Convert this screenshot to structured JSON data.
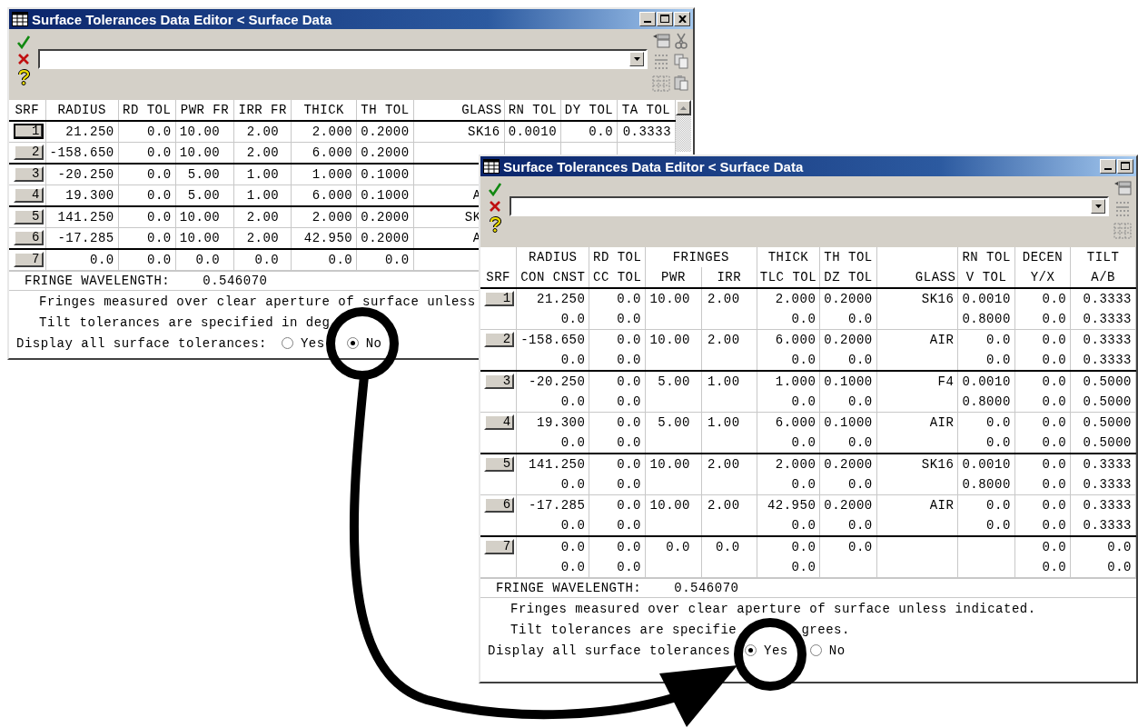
{
  "windows": [
    {
      "title": "Surface Tolerances Data Editor < Surface Data",
      "title_buttons": [
        {
          "kind": "minimize"
        },
        {
          "kind": "maximize"
        },
        {
          "kind": "close"
        }
      ],
      "tool_icons": [
        {
          "kind": "pages"
        },
        {
          "kind": "scissors"
        },
        {
          "kind": "sort"
        },
        {
          "kind": "copy"
        },
        {
          "kind": "grid"
        },
        {
          "kind": "clipboard"
        }
      ],
      "scrollbar": true,
      "header_rows": [
        {
          "srf": "SRF",
          "radius": "RADIUS",
          "rd_tol": "RD TOL",
          "pwr_fr": "PWR FR",
          "irr_fr": "IRR FR",
          "thick": "THICK",
          "th_tol": "TH TOL",
          "glass": "GLASS",
          "rn_tol": "RN TOL",
          "dy_tol": "DY TOL",
          "ta_tol": "TA TOL"
        }
      ],
      "rows": [
        {
          "surface": "1",
          "selected": true,
          "lines": [
            {
              "radius": "21.250",
              "rd_tol": "0.0",
              "pwr_fr": "10.00",
              "irr_fr": "2.00",
              "thick": "2.000",
              "th_tol": "0.2000",
              "glass": "SK16",
              "rn_tol": "0.0010",
              "dy_tol": "0.0",
              "ta_tol": "0.3333"
            }
          ]
        },
        {
          "surface": "2",
          "selected": false,
          "lines": [
            {
              "radius": "-158.650",
              "rd_tol": "0.0",
              "pwr_fr": "10.00",
              "irr_fr": "2.00",
              "thick": "6.000",
              "th_tol": "0.2000"
            }
          ]
        },
        {
          "surface": "3",
          "selected": false,
          "lines": [
            {
              "radius": "-20.250",
              "rd_tol": "0.0",
              "pwr_fr": "5.00",
              "irr_fr": "1.00",
              "thick": "1.000",
              "th_tol": "0.1000"
            }
          ]
        },
        {
          "surface": "4",
          "selected": false,
          "lines": [
            {
              "radius": "19.300",
              "rd_tol": "0.0",
              "pwr_fr": "5.00",
              "irr_fr": "1.00",
              "thick": "6.000",
              "th_tol": "0.1000",
              "glass": "A"
            }
          ]
        },
        {
          "surface": "5",
          "selected": false,
          "lines": [
            {
              "radius": "141.250",
              "rd_tol": "0.0",
              "pwr_fr": "10.00",
              "irr_fr": "2.00",
              "thick": "2.000",
              "th_tol": "0.2000",
              "glass": "SK"
            }
          ]
        },
        {
          "surface": "6",
          "selected": false,
          "lines": [
            {
              "radius": "-17.285",
              "rd_tol": "0.0",
              "pwr_fr": "10.00",
              "irr_fr": "2.00",
              "thick": "42.950",
              "th_tol": "0.2000",
              "glass": "A"
            }
          ]
        },
        {
          "surface": "7",
          "selected": false,
          "lines": [
            {
              "radius": "0.0",
              "rd_tol": "0.0",
              "pwr_fr": "0.0",
              "irr_fr": "0.0",
              "thick": "0.0",
              "th_tol": "0.0"
            }
          ]
        }
      ],
      "fringe_wavelength": {
        "label": "FRINGE WAVELENGTH:",
        "value": "0.546070"
      },
      "notes": [
        [
          "Fringes measured over clear aperture of surface unless"
        ],
        [
          "Tilt tolerances are specified in deg"
        ]
      ],
      "display_all": {
        "label": "Display all surface tolerances:",
        "options": [
          {
            "label": "Yes",
            "selected": false
          },
          {
            "label": "No",
            "selected": true
          }
        ]
      }
    },
    {
      "title": "Surface Tolerances Data Editor < Surface Data",
      "title_buttons": [
        {
          "kind": "minimize"
        },
        {
          "kind": "maximize"
        }
      ],
      "tool_icons": [
        {
          "kind": "pages"
        },
        {
          "kind": "sort"
        },
        {
          "kind": "grid"
        }
      ],
      "scrollbar": false,
      "header_rows": [
        {
          "radius": "RADIUS",
          "rd_tol": "RD TOL",
          "fringes": "FRINGES",
          "thick": "THICK",
          "th_tol": "TH TOL",
          "rn_tol": "RN TOL",
          "decen": "DECEN",
          "tilt": "TILT"
        },
        {
          "srf": "SRF",
          "radius": "CON CNST",
          "rd_tol": "CC TOL",
          "pwr": "PWR",
          "irr": "IRR",
          "thick": "TLC TOL",
          "th_tol": "DZ TOL",
          "glass": "GLASS",
          "rn_tol": "V TOL",
          "decen": "Y/X",
          "tilt": "A/B"
        }
      ],
      "rows": [
        {
          "surface": "1",
          "selected": false,
          "lines": [
            {
              "radius": "21.250",
              "rd_tol": "0.0",
              "pwr": "10.00",
              "irr": "2.00",
              "thick": "2.000",
              "th_tol": "0.2000",
              "glass": "SK16",
              "rn_tol": "0.0010",
              "decen": "0.0",
              "tilt": "0.3333"
            },
            {
              "radius": "0.0",
              "rd_tol": "0.0",
              "thick": "0.0",
              "th_tol": "0.0",
              "rn_tol": "0.8000",
              "decen": "0.0",
              "tilt": "0.3333"
            }
          ]
        },
        {
          "surface": "2",
          "selected": false,
          "lines": [
            {
              "radius": "-158.650",
              "rd_tol": "0.0",
              "pwr": "10.00",
              "irr": "2.00",
              "thick": "6.000",
              "th_tol": "0.2000",
              "glass": "AIR",
              "rn_tol": "0.0",
              "decen": "0.0",
              "tilt": "0.3333"
            },
            {
              "radius": "0.0",
              "rd_tol": "0.0",
              "thick": "0.0",
              "th_tol": "0.0",
              "rn_tol": "0.0",
              "decen": "0.0",
              "tilt": "0.3333"
            }
          ]
        },
        {
          "surface": "3",
          "selected": false,
          "lines": [
            {
              "radius": "-20.250",
              "rd_tol": "0.0",
              "pwr": "5.00",
              "irr": "1.00",
              "thick": "1.000",
              "th_tol": "0.1000",
              "glass": "F4",
              "rn_tol": "0.0010",
              "decen": "0.0",
              "tilt": "0.5000"
            },
            {
              "radius": "0.0",
              "rd_tol": "0.0",
              "thick": "0.0",
              "th_tol": "0.0",
              "rn_tol": "0.8000",
              "decen": "0.0",
              "tilt": "0.5000"
            }
          ]
        },
        {
          "surface": "4",
          "selected": false,
          "lines": [
            {
              "radius": "19.300",
              "rd_tol": "0.0",
              "pwr": "5.00",
              "irr": "1.00",
              "thick": "6.000",
              "th_tol": "0.1000",
              "glass": "AIR",
              "rn_tol": "0.0",
              "decen": "0.0",
              "tilt": "0.5000"
            },
            {
              "radius": "0.0",
              "rd_tol": "0.0",
              "thick": "0.0",
              "th_tol": "0.0",
              "rn_tol": "0.0",
              "decen": "0.0",
              "tilt": "0.5000"
            }
          ]
        },
        {
          "surface": "5",
          "selected": false,
          "lines": [
            {
              "radius": "141.250",
              "rd_tol": "0.0",
              "pwr": "10.00",
              "irr": "2.00",
              "thick": "2.000",
              "th_tol": "0.2000",
              "glass": "SK16",
              "rn_tol": "0.0010",
              "decen": "0.0",
              "tilt": "0.3333"
            },
            {
              "radius": "0.0",
              "rd_tol": "0.0",
              "thick": "0.0",
              "th_tol": "0.0",
              "rn_tol": "0.8000",
              "decen": "0.0",
              "tilt": "0.3333"
            }
          ]
        },
        {
          "surface": "6",
          "selected": false,
          "lines": [
            {
              "radius": "-17.285",
              "rd_tol": "0.0",
              "pwr": "10.00",
              "irr": "2.00",
              "thick": "42.950",
              "th_tol": "0.2000",
              "glass": "AIR",
              "rn_tol": "0.0",
              "decen": "0.0",
              "tilt": "0.3333"
            },
            {
              "radius": "0.0",
              "rd_tol": "0.0",
              "thick": "0.0",
              "th_tol": "0.0",
              "rn_tol": "0.0",
              "decen": "0.0",
              "tilt": "0.3333"
            }
          ]
        },
        {
          "surface": "7",
          "selected": false,
          "lines": [
            {
              "radius": "0.0",
              "rd_tol": "0.0",
              "pwr": "0.0",
              "irr": "0.0",
              "thick": "0.0",
              "th_tol": "0.0",
              "decen": "0.0",
              "tilt": "0.0"
            },
            {
              "radius": "0.0",
              "rd_tol": "0.0",
              "thick": "0.0",
              "decen": "0.0",
              "tilt": "0.0"
            }
          ]
        }
      ],
      "fringe_wavelength": {
        "label": "FRINGE WAVELENGTH:",
        "value": "0.546070"
      },
      "notes": [
        [
          "Fringes measured over clear aperture of surface unless indicated."
        ],
        [
          "Tilt tolerances are specifie",
          "grees."
        ]
      ],
      "display_all": {
        "label": "Display all surface tolerances",
        "options": [
          {
            "label": "Yes",
            "selected": true
          },
          {
            "label": "No",
            "selected": false
          }
        ]
      }
    }
  ]
}
